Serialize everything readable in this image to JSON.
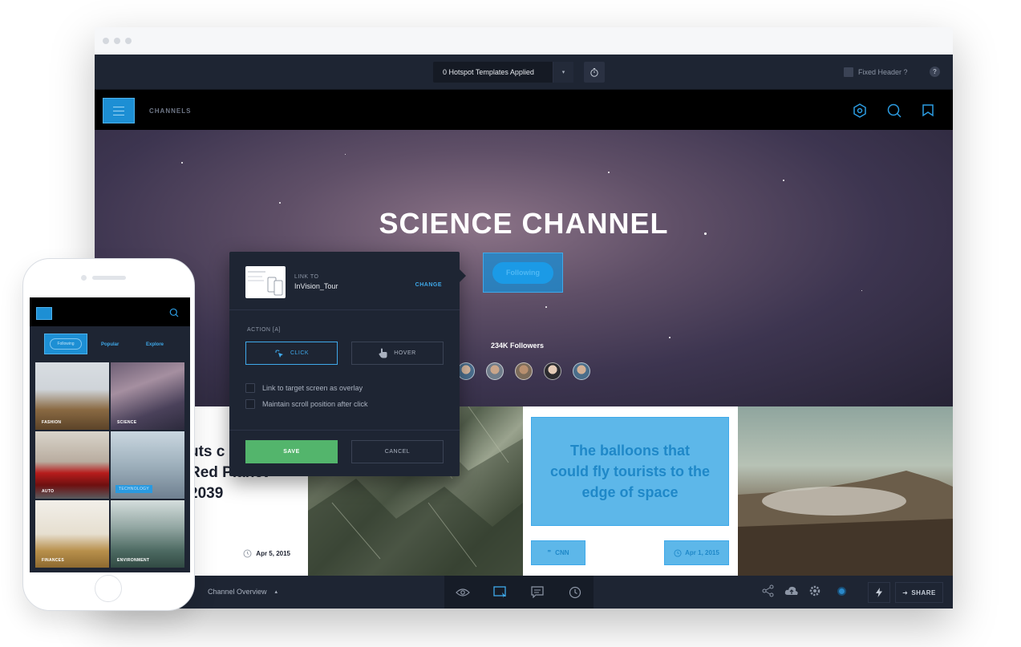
{
  "toolbar": {
    "templates_label": "0 Hotspot Templates Applied",
    "fixed_header_label": "Fixed Header ?",
    "help_label": "?"
  },
  "appbar": {
    "channels_label": "CHANNELS"
  },
  "hero": {
    "title": "SCIENCE CHANNEL",
    "follow_label": "Following",
    "followers": "234K Followers"
  },
  "cards": {
    "text_headline": "uts c\nRed Planet\n2039",
    "text_date": "Apr 5, 2015",
    "balloon_headline": "The balloons that could fly tourists to the edge of space",
    "balloon_source": "CNN",
    "balloon_date": "Apr 1, 2015"
  },
  "popover": {
    "link_to_label": "LINK TO",
    "link_target": "InVision_Tour",
    "change_label": "CHANGE",
    "action_label": "ACTION [A]",
    "click_label": "CLICK",
    "hover_label": "HOVER",
    "option_overlay": "Link to target screen as overlay",
    "option_scroll": "Maintain scroll position after click",
    "save_label": "SAVE",
    "cancel_label": "CANCEL"
  },
  "bottombar": {
    "screen_name": "Channel Overview",
    "share_label": "SHARE"
  },
  "phone": {
    "tabs": {
      "following": "Following",
      "popular": "Popular",
      "explore": "Explore"
    },
    "tiles": [
      {
        "label": "FASHION"
      },
      {
        "label": "SCIENCE"
      },
      {
        "label": "AUTO"
      },
      {
        "label": "TECHNOLOGY"
      },
      {
        "label": "FINANCES"
      },
      {
        "label": "ENVIRONMENT"
      }
    ]
  },
  "colors": {
    "accent_blue": "#3fa9ea",
    "save_green": "#53b56c",
    "dark_panel": "#1e2533"
  },
  "icons": [
    "timer-icon",
    "menu-icon",
    "hexagon-icon",
    "search-icon",
    "bookmark-icon",
    "cursor-click-icon",
    "hand-hover-icon",
    "clock-icon",
    "eye-icon",
    "hotspot-icon",
    "comment-icon",
    "history-icon",
    "share-nodes-icon",
    "cloud-upload-icon",
    "gear-icon",
    "bolt-icon",
    "arrow-right-icon"
  ]
}
